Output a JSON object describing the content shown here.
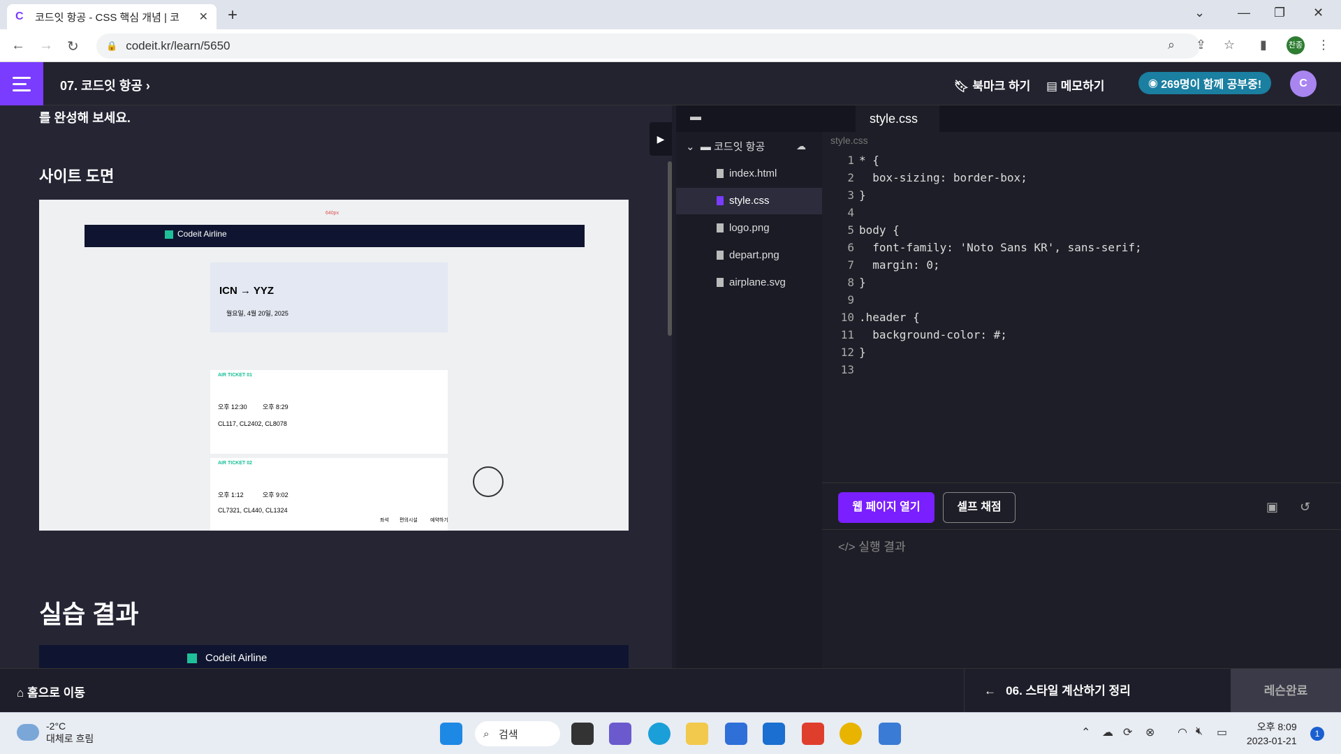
{
  "browser": {
    "tab_title": "코드잇 항공 - CSS 핵심 개념 | 코",
    "url": "codeit.kr/learn/5650"
  },
  "app": {
    "breadcrumb": "07. 코드잇 항공",
    "bookmark_label": "북마크 하기",
    "memo_label": "메모하기",
    "live_label": "269명이 함께 공부중!"
  },
  "content": {
    "intro_text": "를 완성해 보세요.",
    "section_title": "사이트 도면",
    "result_title": "실습 결과",
    "diagram": {
      "brand": "Codeit Airline",
      "route": "ICN → YYZ",
      "date": "월요일, 4월 20일, 2025",
      "ticket1": "AIR TICKET 01",
      "time1": "오후 12:30",
      "time1b": "오후 8:29",
      "flights1": "CL117, CL2402, CL8078",
      "ticket2": "AIR TICKET 02",
      "time2": "오후 1:12",
      "time2b": "오후 9:02",
      "flights2": "CL7321, CL440, CL1324",
      "opts": [
        "좌석",
        "편의시설",
        "예약하기"
      ],
      "width_label": "640px"
    },
    "result_brand": "Codeit Airline"
  },
  "filetree": {
    "folder": "코드잇 항공",
    "files": [
      "index.html",
      "style.css",
      "logo.png",
      "depart.png",
      "airplane.svg"
    ],
    "active_index": 1
  },
  "editor": {
    "tab": "style.css",
    "path": "style.css",
    "lines": [
      "* {",
      "  box-sizing: border-box;",
      "}",
      "",
      "body {",
      "  font-family: 'Noto Sans KR', sans-serif;",
      "  margin: 0;",
      "}",
      "",
      ".header {",
      "  background-color: #;",
      "}",
      ""
    ],
    "open_page_label": "웹 페이지 열기",
    "self_grade_label": "셀프 채점",
    "result_label": "</> 실행 결과"
  },
  "footer": {
    "home_label": "홈으로 이동",
    "prev_label": "06. 스타일 계산하기 정리",
    "complete_label": "레슨완료"
  },
  "taskbar": {
    "temp": "-2°C",
    "weather": "대체로 흐림",
    "search": "검색",
    "time": "오후 8:09",
    "date": "2023-01-21",
    "notif": "1"
  },
  "colors": {
    "accent": "#7a1fff",
    "live": "#1a7fa0"
  }
}
